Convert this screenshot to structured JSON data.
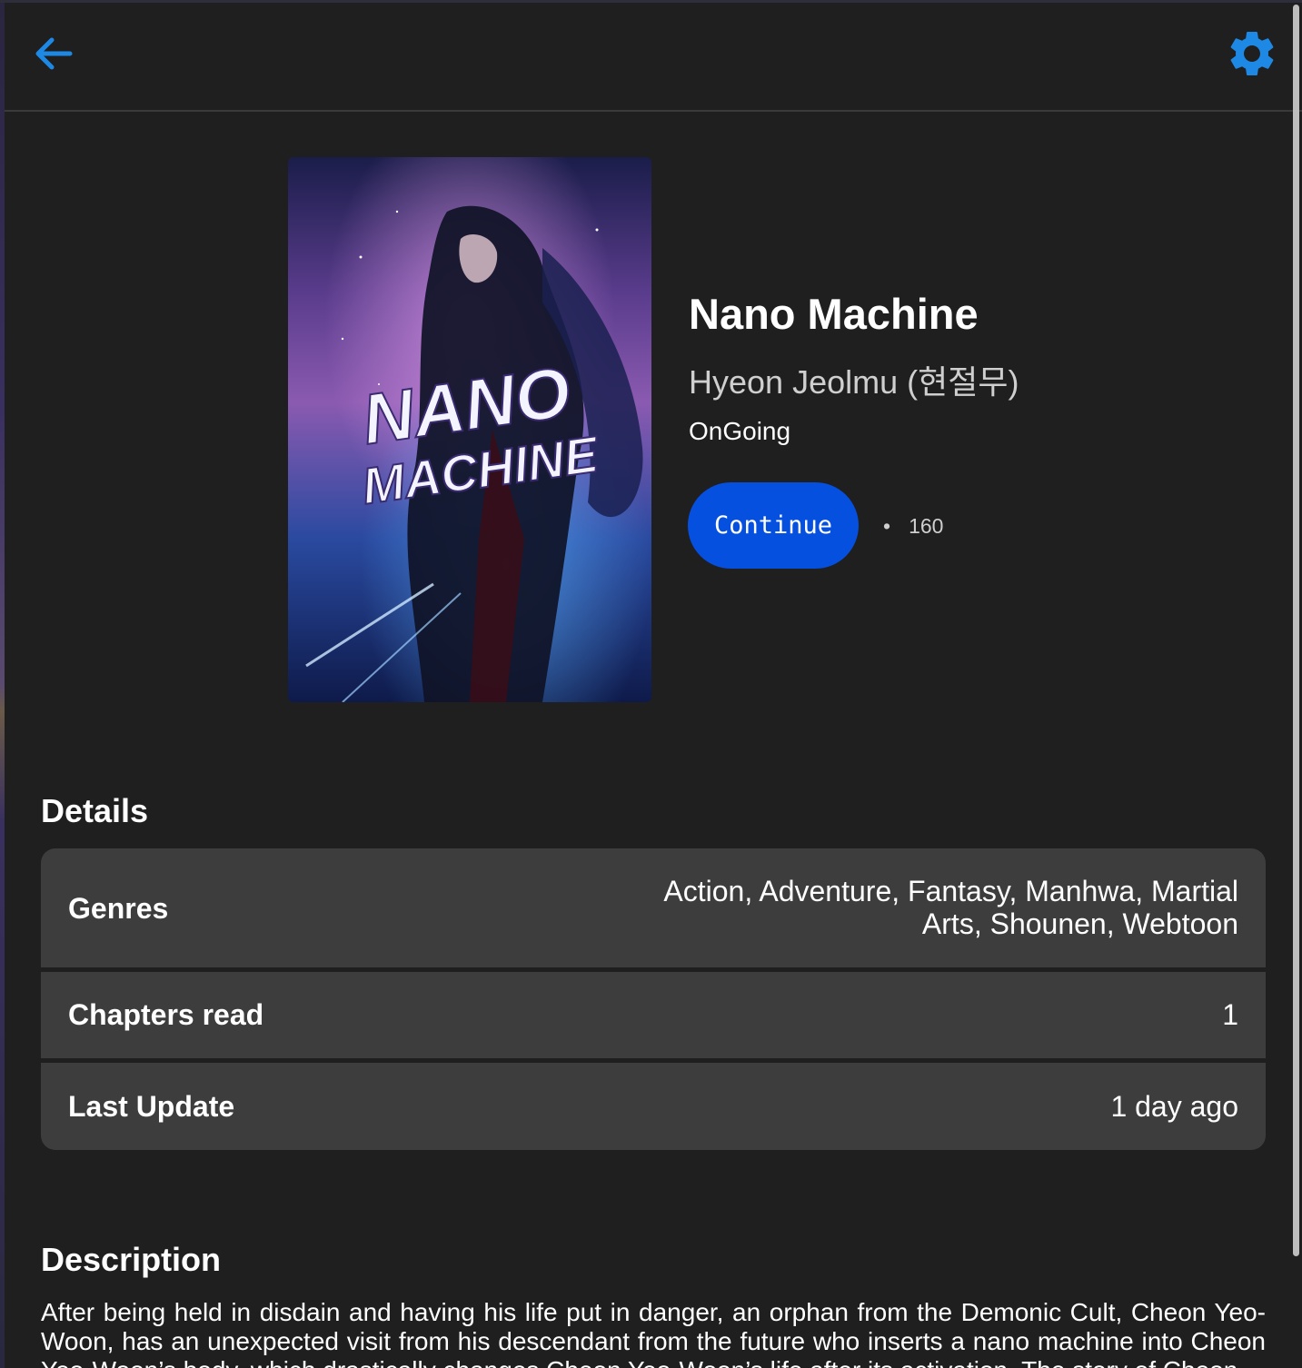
{
  "header": {
    "back_icon": "arrow-back-icon",
    "settings_icon": "gear-icon",
    "accent_color": "#1e88e5"
  },
  "manga": {
    "cover_text_line1": "NANO",
    "cover_text_line2": "MACHINE",
    "title": "Nano Machine",
    "author": "Hyeon Jeolmu (현절무)",
    "status": "OnGoing",
    "continue_label": "Continue",
    "bullet": "•",
    "chapter_count": "160",
    "continue_color": "#0650e0"
  },
  "details": {
    "section_title": "Details",
    "rows": [
      {
        "label": "Genres",
        "value": "Action, Adventure, Fantasy, Manhwa, Martial Arts, Shounen, Webtoon"
      },
      {
        "label": "Chapters read",
        "value": "1"
      },
      {
        "label": "Last Update",
        "value": "1 day ago"
      }
    ]
  },
  "description": {
    "section_title": "Description",
    "text": "After being held in disdain and having his life put in danger, an orphan from the Demonic Cult, Cheon Yeo-Woon, has an unexpected visit from his descendant from the future who inserts a nano machine into Cheon Yeo-Woon’s body, which drastically changes Cheon Yeo-Woon’s life after its activation. The story of Cheon"
  }
}
